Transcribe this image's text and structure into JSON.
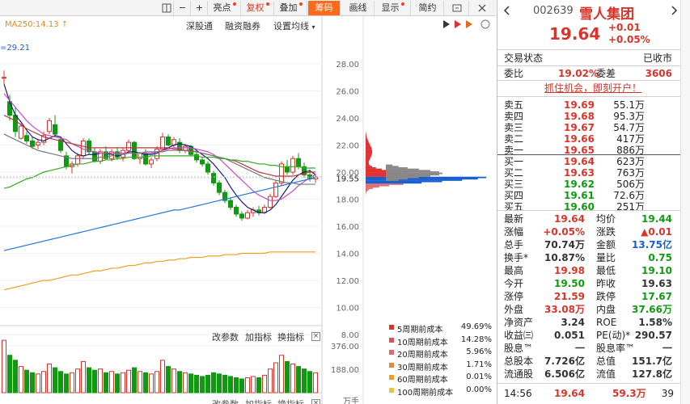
{
  "toolbar": {
    "items": [
      {
        "label": "",
        "name": "layout-icon"
      },
      {
        "label": "−",
        "name": "zoom-out-button"
      },
      {
        "label": "+",
        "name": "zoom-in-button"
      },
      {
        "label": "亮点",
        "dot": true
      },
      {
        "label": "复权",
        "dot": true
      },
      {
        "label": "叠加",
        "dot": true
      },
      {
        "label": "筹码",
        "active": true
      },
      {
        "label": "画线"
      },
      {
        "label": "显示",
        "dot": true
      },
      {
        "label": "简约"
      },
      {
        "label": "",
        "name": "expand-icon"
      },
      {
        "label": "",
        "name": "close-icon"
      }
    ]
  },
  "chart_header": {
    "ma250": "MA250:14.13 ↑",
    "ma_second": "=29.21",
    "links": [
      "深股通",
      "融资融券",
      "设置均线"
    ]
  },
  "price_axis": [
    "28.00",
    "26.00",
    "24.00",
    "22.00",
    "20.00",
    "19.55",
    "18.00",
    "16.00",
    "14.00",
    "12.00",
    "10.00",
    "8.00"
  ],
  "vol_axis": [
    "376.00",
    "188.00",
    "万手"
  ],
  "sub_panel": {
    "labels": [
      "改参数",
      "加指标",
      "换指标"
    ]
  },
  "chip_legend": [
    {
      "label": "5周期前成本",
      "value": "49.69%",
      "color": "#d8352a"
    },
    {
      "label": "10周期前成本",
      "value": "14.28%",
      "color": "#e05050"
    },
    {
      "label": "20周期前成本",
      "value": "5.96%",
      "color": "#e06a6a"
    },
    {
      "label": "30周期前成本",
      "value": "1.71%",
      "color": "#e08a3a"
    },
    {
      "label": "60周期前成本",
      "value": "0.01%",
      "color": "#f0a020"
    },
    {
      "label": "100周期前成本",
      "value": "0.00%",
      "color": "#f0c040"
    }
  ],
  "colors": {
    "up": "#d8352a",
    "down": "#119911",
    "accent": "#ff6a1a"
  },
  "chart_data": [
    {
      "type": "candlestick",
      "title": "",
      "ylim": [
        7.3,
        29.5
      ],
      "ohlc": [
        [
          27.0,
          27.5,
          26.5,
          27.0
        ],
        [
          25.2,
          25.7,
          23.8,
          24.2
        ],
        [
          24.2,
          24.8,
          22.6,
          23.0
        ],
        [
          22.5,
          23.6,
          22.4,
          23.4
        ],
        [
          22.7,
          23.0,
          22.1,
          22.3
        ],
        [
          22.3,
          22.6,
          21.7,
          21.9
        ],
        [
          22.0,
          22.4,
          21.7,
          22.2
        ],
        [
          22.2,
          23.0,
          22.0,
          22.7
        ],
        [
          23.0,
          24.0,
          22.8,
          23.8
        ],
        [
          23.5,
          24.2,
          22.6,
          22.8
        ],
        [
          22.4,
          22.6,
          21.4,
          21.6
        ],
        [
          21.2,
          21.5,
          20.2,
          20.4
        ],
        [
          20.4,
          20.8,
          19.9,
          20.6
        ],
        [
          20.6,
          21.4,
          20.4,
          21.2
        ],
        [
          21.2,
          22.5,
          21.0,
          22.3
        ],
        [
          22.3,
          22.5,
          21.3,
          21.5
        ],
        [
          21.5,
          21.8,
          20.7,
          20.8
        ],
        [
          20.8,
          21.7,
          20.6,
          21.5
        ],
        [
          21.5,
          21.9,
          20.9,
          21.0
        ],
        [
          21.0,
          21.7,
          20.8,
          21.5
        ],
        [
          21.5,
          21.8,
          20.9,
          21.1
        ],
        [
          21.1,
          21.8,
          20.8,
          21.6
        ],
        [
          21.6,
          22.4,
          21.4,
          22.2
        ],
        [
          22.2,
          22.3,
          20.9,
          21.0
        ],
        [
          21.0,
          21.5,
          20.6,
          21.4
        ],
        [
          21.4,
          21.7,
          20.5,
          20.6
        ],
        [
          20.6,
          21.1,
          20.3,
          20.9
        ],
        [
          21.0,
          21.9,
          20.8,
          21.7
        ],
        [
          21.7,
          22.9,
          21.6,
          22.6
        ],
        [
          22.6,
          22.8,
          21.9,
          22.0
        ],
        [
          22.0,
          22.6,
          21.8,
          22.4
        ],
        [
          22.2,
          22.5,
          21.4,
          21.6
        ],
        [
          21.6,
          22.1,
          21.4,
          21.9
        ],
        [
          21.9,
          22.0,
          21.2,
          21.3
        ],
        [
          21.3,
          21.5,
          20.7,
          20.9
        ],
        [
          20.9,
          21.1,
          20.4,
          20.6
        ],
        [
          20.6,
          20.8,
          19.8,
          20.0
        ],
        [
          19.9,
          20.1,
          19.0,
          19.2
        ],
        [
          19.2,
          19.4,
          18.3,
          18.5
        ],
        [
          18.5,
          18.7,
          17.7,
          17.9
        ],
        [
          17.9,
          18.1,
          17.2,
          17.4
        ],
        [
          17.4,
          17.6,
          16.7,
          16.9
        ],
        [
          16.9,
          17.1,
          16.4,
          16.6
        ],
        [
          16.6,
          17.2,
          16.5,
          17.0
        ],
        [
          17.0,
          17.4,
          16.7,
          17.2
        ],
        [
          17.2,
          17.5,
          16.8,
          17.0
        ],
        [
          17.0,
          17.6,
          16.9,
          17.4
        ],
        [
          17.4,
          18.4,
          17.3,
          18.2
        ],
        [
          18.2,
          19.4,
          18.1,
          19.2
        ],
        [
          19.2,
          20.8,
          19.0,
          20.6
        ],
        [
          20.4,
          20.9,
          19.8,
          20.0
        ],
        [
          20.0,
          21.2,
          19.8,
          21.0
        ],
        [
          21.0,
          21.4,
          20.2,
          20.4
        ],
        [
          20.4,
          20.7,
          19.6,
          19.8
        ],
        [
          19.8,
          20.2,
          19.3,
          19.5
        ],
        [
          19.5,
          19.9,
          19.2,
          19.64
        ]
      ],
      "series": [
        {
          "name": "MA5",
          "color": "#1a1a80",
          "values": [
            26.5,
            25.2,
            24.2,
            23.7,
            23.1,
            22.6,
            22.4,
            22.3,
            22.5,
            22.7,
            22.6,
            22.1,
            21.6,
            21.3,
            21.2,
            21.3,
            21.3,
            21.4,
            21.4,
            21.3,
            21.2,
            21.3,
            21.5,
            21.5,
            21.4,
            21.3,
            21.3,
            21.4,
            21.6,
            21.8,
            22.0,
            22.1,
            22.0,
            21.9,
            21.6,
            21.3,
            21.0,
            20.6,
            20.1,
            19.6,
            18.9,
            18.3,
            17.8,
            17.4,
            17.2,
            17.0,
            17.0,
            17.2,
            17.6,
            18.2,
            18.8,
            19.4,
            19.8,
            20.0,
            20.1,
            19.8
          ]
        },
        {
          "name": "MA10",
          "color": "#c24cc2",
          "values": [
            25.8,
            25.3,
            24.8,
            24.3,
            23.8,
            23.4,
            23.1,
            22.8,
            22.7,
            22.6,
            22.5,
            22.4,
            22.1,
            21.9,
            21.7,
            21.6,
            21.5,
            21.4,
            21.4,
            21.4,
            21.4,
            21.4,
            21.4,
            21.4,
            21.4,
            21.4,
            21.4,
            21.5,
            21.6,
            21.7,
            21.8,
            21.8,
            21.8,
            21.8,
            21.7,
            21.6,
            21.5,
            21.3,
            21.0,
            20.6,
            20.2,
            19.8,
            19.4,
            19.0,
            18.6,
            18.3,
            18.1,
            17.9,
            17.9,
            18.0,
            18.3,
            18.6,
            19.0,
            19.3,
            19.6,
            19.8
          ]
        },
        {
          "name": "MA20",
          "color": "#b23a3a",
          "values": [
            24.2,
            24.0,
            23.8,
            23.5,
            23.2,
            23.0,
            22.8,
            22.6,
            22.5,
            22.4,
            22.3,
            22.2,
            22.1,
            22.0,
            21.9,
            21.8,
            21.8,
            21.8,
            21.8,
            21.8,
            21.8,
            21.8,
            21.8,
            21.8,
            21.8,
            21.8,
            21.8,
            21.8,
            21.8,
            21.8,
            21.7,
            21.7,
            21.6,
            21.6,
            21.5,
            21.4,
            21.3,
            21.2,
            21.1,
            21.0,
            20.9,
            20.8,
            20.6,
            20.4,
            20.2,
            20.0,
            19.9,
            19.8,
            19.7,
            19.7,
            19.7,
            19.7,
            19.8,
            19.9,
            20.0,
            20.0
          ]
        },
        {
          "name": "MA30",
          "color": "#777777",
          "values": [
            22.8,
            22.6,
            22.4,
            22.2,
            22.0,
            21.8,
            21.6,
            21.5,
            21.4,
            21.3,
            21.2,
            21.1,
            21.0,
            21.0,
            21.0,
            21.0,
            21.0,
            21.1,
            21.1,
            21.2,
            21.3,
            21.3,
            21.4,
            21.4,
            21.4,
            21.5,
            21.5,
            21.5,
            21.5,
            21.6,
            21.6,
            21.6,
            21.6,
            21.5,
            21.5,
            21.4,
            21.3,
            21.2,
            21.1,
            21.0,
            20.8,
            20.6,
            20.4,
            20.2,
            20.0,
            19.8,
            19.6,
            19.5,
            19.4,
            19.3,
            19.2,
            19.2,
            19.1,
            19.1,
            19.1,
            19.1
          ]
        },
        {
          "name": "MA60",
          "color": "#33aa22",
          "values": [
            18.8,
            18.9,
            19.1,
            19.3,
            19.5,
            19.6,
            19.8,
            20.0,
            20.1,
            20.2,
            20.3,
            20.4,
            20.5,
            20.6,
            20.6,
            20.7,
            20.8,
            20.8,
            20.9,
            20.9,
            21.0,
            21.0,
            21.1,
            21.1,
            21.1,
            21.1,
            21.2,
            21.2,
            21.2,
            21.2,
            21.2,
            21.2,
            21.2,
            21.2,
            21.2,
            21.1,
            21.1,
            21.1,
            21.0,
            21.0,
            20.9,
            20.9,
            20.8,
            20.8,
            20.7,
            20.6,
            20.6,
            20.5,
            20.5,
            20.4,
            20.4,
            20.4,
            20.4,
            20.3,
            20.3,
            20.3
          ]
        },
        {
          "name": "MA120",
          "color": "#2277dd",
          "values": [
            14.2,
            14.3,
            14.4,
            14.5,
            14.6,
            14.7,
            14.8,
            14.9,
            15.0,
            15.1,
            15.2,
            15.3,
            15.4,
            15.5,
            15.6,
            15.7,
            15.8,
            15.9,
            16.0,
            16.1,
            16.2,
            16.3,
            16.4,
            16.5,
            16.6,
            16.7,
            16.8,
            16.9,
            17.0,
            17.1,
            17.2,
            17.2,
            17.3,
            17.4,
            17.5,
            17.6,
            17.7,
            17.8,
            17.9,
            18.0,
            18.1,
            18.2,
            18.3,
            18.4,
            18.5,
            18.6,
            18.7,
            18.8,
            18.9,
            19.0,
            19.1,
            19.2,
            19.3,
            19.4,
            19.5,
            19.6
          ]
        },
        {
          "name": "MA250",
          "color": "#f0a020",
          "values": [
            11.3,
            11.4,
            11.5,
            11.6,
            11.7,
            11.8,
            11.9,
            12.0,
            12.0,
            12.1,
            12.2,
            12.3,
            12.4,
            12.4,
            12.5,
            12.6,
            12.7,
            12.7,
            12.8,
            12.9,
            12.9,
            13.0,
            13.1,
            13.1,
            13.2,
            13.3,
            13.3,
            13.4,
            13.4,
            13.5,
            13.5,
            13.6,
            13.6,
            13.7,
            13.7,
            13.7,
            13.8,
            13.8,
            13.8,
            13.9,
            13.9,
            13.9,
            14.0,
            14.0,
            14.0,
            14.0,
            14.0,
            14.1,
            14.1,
            14.1,
            14.1,
            14.1,
            14.1,
            14.1,
            14.1,
            14.1
          ]
        }
      ]
    },
    {
      "type": "bar",
      "title": "",
      "ylabel": "万手",
      "ylim": [
        0,
        460
      ],
      "values": [
        420,
        300,
        260,
        210,
        180,
        160,
        150,
        170,
        230,
        200,
        170,
        150,
        160,
        190,
        250,
        200,
        180,
        190,
        160,
        170,
        150,
        160,
        180,
        200,
        170,
        160,
        150,
        170,
        260,
        210,
        190,
        170,
        160,
        150,
        140,
        130,
        140,
        160,
        150,
        140,
        130,
        120,
        110,
        120,
        130,
        120,
        140,
        190,
        240,
        300,
        250,
        230,
        210,
        190,
        170,
        160
      ],
      "up": [
        1,
        0,
        0,
        1,
        0,
        0,
        1,
        1,
        1,
        0,
        0,
        0,
        1,
        1,
        1,
        0,
        0,
        1,
        0,
        1,
        0,
        1,
        1,
        0,
        1,
        0,
        1,
        1,
        1,
        0,
        1,
        0,
        1,
        0,
        0,
        0,
        0,
        0,
        0,
        0,
        0,
        0,
        0,
        1,
        1,
        0,
        1,
        1,
        1,
        1,
        0,
        1,
        0,
        0,
        0,
        1
      ]
    }
  ],
  "panel": {
    "code": "002639",
    "name": "雪人集团",
    "price": "19.64",
    "change": "+0.01",
    "change_pct": "+0.05%",
    "status_label": "交易状态",
    "status_value": "已收市",
    "webi_label": "委比",
    "webi_value": "19.02%",
    "weicha_label": "委差",
    "weicha_value": "3606",
    "promo": "抓住机会，即刻开户！",
    "sells": [
      {
        "label": "卖五",
        "price": "19.69",
        "vol": "55.1万"
      },
      {
        "label": "卖四",
        "price": "19.68",
        "vol": "95.3万"
      },
      {
        "label": "卖三",
        "price": "19.67",
        "vol": "54.7万"
      },
      {
        "label": "卖二",
        "price": "19.66",
        "vol": "417万"
      },
      {
        "label": "卖一",
        "price": "19.65",
        "vol": "886万"
      }
    ],
    "buys": [
      {
        "label": "买一",
        "price": "19.64",
        "vol": "623万"
      },
      {
        "label": "买二",
        "price": "19.63",
        "vol": "763万"
      },
      {
        "label": "买三",
        "price": "19.62",
        "vol": "506万"
      },
      {
        "label": "买四",
        "price": "19.61",
        "vol": "72.6万"
      },
      {
        "label": "买五",
        "price": "19.60",
        "vol": "251万"
      }
    ],
    "stats": [
      {
        "l1": "最新",
        "v1": "19.64",
        "c1": "red",
        "l2": "均价",
        "v2": "19.44",
        "c2": "green"
      },
      {
        "l1": "涨幅",
        "v1": "+0.05%",
        "c1": "red",
        "l2": "涨跌",
        "v2": "▲0.01",
        "c2": "red"
      },
      {
        "l1": "总手",
        "v1": "70.74万",
        "c1": "gray",
        "l2": "金额",
        "v2": "13.75亿",
        "c2": "blue"
      },
      {
        "l1": "换手*",
        "v1": "10.87%",
        "c1": "gray",
        "l2": "量比",
        "v2": "0.75",
        "c2": "green"
      },
      {
        "l1": "最高",
        "v1": "19.98",
        "c1": "red",
        "l2": "最低",
        "v2": "19.10",
        "c2": "green"
      },
      {
        "l1": "今开",
        "v1": "19.50",
        "c1": "green",
        "l2": "昨收",
        "v2": "19.63",
        "c2": "gray"
      },
      {
        "l1": "涨停",
        "v1": "21.59",
        "c1": "red",
        "l2": "跌停",
        "v2": "17.67",
        "c2": "green"
      },
      {
        "l1": "外盘",
        "v1": "33.08万",
        "c1": "red",
        "l2": "内盘",
        "v2": "37.66万",
        "c2": "green"
      },
      {
        "l1": "净资产",
        "v1": "3.24",
        "c1": "gray",
        "l2": "ROE",
        "v2": "1.58%",
        "c2": "gray"
      },
      {
        "l1": "收益㈢",
        "v1": "0.051",
        "c1": "gray",
        "l2": "PE(动)*",
        "v2": "290.57",
        "c2": "gray"
      },
      {
        "l1": "股息™",
        "v1": "一",
        "c1": "gray",
        "l2": "股息率™",
        "v2": "一",
        "c2": "gray"
      },
      {
        "l1": "总股本",
        "v1": "7.726亿",
        "c1": "gray",
        "l2": "总值",
        "v2": "151.7亿",
        "c2": "gray"
      },
      {
        "l1": "流通股",
        "v1": "6.506亿",
        "c1": "gray",
        "l2": "流值",
        "v2": "127.8亿",
        "c2": "gray"
      }
    ],
    "tick": {
      "time": "14:56",
      "price": "19.64",
      "vol": "59.3万",
      "num": "39"
    }
  }
}
